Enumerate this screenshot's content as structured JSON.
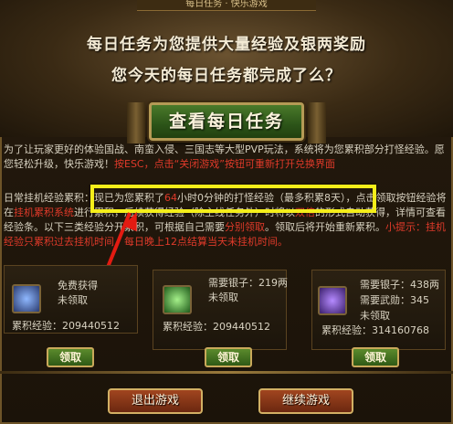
{
  "header": {
    "window_title": "每日任务 · 快乐游戏",
    "headline_1": "每日任务为您提供大量经验及银两奖励",
    "headline_2": "您今天的每日任务都完成了么？",
    "view_button": "查看每日任务"
  },
  "intro": {
    "text": "为了让玩家更好的体验国战、南蛮入侵、三国志等大型PVP玩法，系统将为您累积部分打怪经验。愿您轻松升级，快乐游戏！",
    "red_text": "按ESC，点击“关闭游戏”按钮可重新打开兑换界面"
  },
  "afk": {
    "part_1": "日常挂机经验累积：",
    "highlight_1": "现已为您累积了",
    "hours": "64",
    "highlight_2": "小时0分钟的打怪经验（最多积累8天）",
    "part_2": "，点击领取按钮经验将在",
    "red_1": "挂机累积系统",
    "part_3": "进行累积，后续获得经验（除主线任务外）时将以",
    "red_2": "双倍",
    "part_4": "的形式自动获得，详情可查看经验条。以下三类经验分开累积，可根据自己需要",
    "red_3": "分别领取",
    "part_5": "。领取后将开始重新累积。",
    "tip": "小提示：挂机经验只累积过去挂机时间，每日晚上12点结算当天未挂机时间。"
  },
  "rewards": [
    {
      "line_1": "免费获得",
      "line_2": "未领取",
      "line_3": "",
      "exp_label": "累积经验：",
      "exp_value": "209440512",
      "claim": "领取",
      "icon": "exp-book-icon"
    },
    {
      "line_1": "需要银子：219两",
      "line_2": "未领取",
      "line_3": "",
      "exp_label": "累积经验：",
      "exp_value": "209440512",
      "claim": "领取",
      "icon": "exp-scroll-icon"
    },
    {
      "line_1": "需要银子：438两",
      "line_2": "需要武勋：345",
      "line_3": "未领取",
      "exp_label": "累积经验：",
      "exp_value": "314160768",
      "claim": "领取",
      "icon": "exp-crystal-icon"
    }
  ],
  "footer": {
    "exit_button": "退出游戏",
    "continue_button": "继续游戏"
  },
  "colors": {
    "highlight_border": "#f5ee1a",
    "arrow": "#e31b12",
    "warning_text": "#e03a2a"
  }
}
